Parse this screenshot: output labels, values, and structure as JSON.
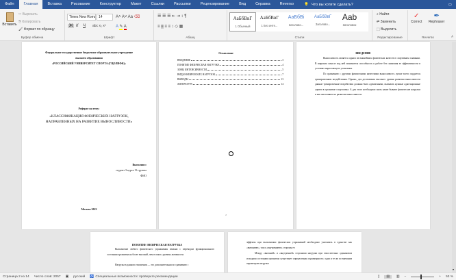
{
  "tabs": [
    "Файл",
    "Главная",
    "Вставка",
    "Рисование",
    "Конструктор",
    "Макет",
    "Ссылки",
    "Рассылки",
    "Рецензирование",
    "Вид",
    "Справка",
    "Reverso"
  ],
  "tell_me": "Что вы хотите сделать?",
  "clipboard": {
    "paste": "Вставить",
    "cut": "Вырезать",
    "copy": "Копировать",
    "format_painter": "Формат по образцу",
    "label": "Буфер обмена"
  },
  "font": {
    "name": "Times New Roman",
    "size": "14",
    "label": "Шрифт",
    "bold": "Ж",
    "italic": "К",
    "underline": "Ч"
  },
  "paragraph": {
    "label": "Абзац"
  },
  "styles": {
    "label": "Стили",
    "items": [
      {
        "preview": "АаБбВвГ",
        "name": "1 Обычный"
      },
      {
        "preview": "АаБбВвГ",
        "name": "1 Без инте..."
      },
      {
        "preview": "АаБбВі",
        "name": "Заголово..."
      },
      {
        "preview": "АаБбВвГ",
        "name": "Заголово..."
      },
      {
        "preview": "Aab",
        "name": "Заголовок"
      },
      {
        "preview": "АаБбВвГ",
        "name": "Подзагол..."
      }
    ]
  },
  "editing": {
    "label": "Редактирование",
    "find": "Найти",
    "replace": "Заменить",
    "select": "Выделить"
  },
  "reverso": {
    "label": "Reverso",
    "correct": "Correct",
    "rephraser": "Rephraser"
  },
  "page1": {
    "org1": "Федеральное государственное бюджетное образовательное учреждение",
    "org2": "высшего образования",
    "org3": "«РОССИЙСКИЙ УНИВЕРСИТЕТ СПОРТА (ГЦОЛИФК)»",
    "ref": "Реферат на тему:",
    "title1": "«КЛАССИФИКАЦИЯ ФИЗИЧЕСКИХ НАГРУЗОК,",
    "title2": "НАПРАВЛЕННЫХ НА РАЗВИТИЕ ВЫНОСЛИВОСТИ»",
    "done": "Выполнил:",
    "student": "студент 3 курса 13 группы",
    "fio": "ФИО",
    "city": "Москва 2022"
  },
  "page2": {
    "heading": "Оглавление",
    "toc": [
      {
        "t": "ВВЕДЕНИЕ",
        "p": "3"
      },
      {
        "t": "ПОНЯТИЕ ФИЗИЧЕСКАЯ НАГРУЗКА",
        "p": "4"
      },
      {
        "t": "ЗОНЫ ИНТЕНСИВНОСТИ",
        "p": "5"
      },
      {
        "t": "ВИДЫ ФИЗИЧЕСКИХ НАГРУЗОК",
        "p": "7"
      },
      {
        "t": "ВЫВОДЫ",
        "p": "13"
      },
      {
        "t": "ЛИТЕРАТУРА",
        "p": "14"
      }
    ],
    "num": "2"
  },
  "page3": {
    "heading": "ВВЕДЕНИЕ",
    "p1": "Выносливость является одним из важнейших физических качеств в спортивном плавании. В широком смысле под ней понимается способность к работе без снижения ее эффективности в условиях нарастающего утомления.",
    "p2": "По сравнению с другими физическими качествами выносливость лучше всего поддается тренировочным воздействиям. Однако, для достижения высокого уровня развития выносливости данные тренировочные воздействия должны быть адекватными, вызывать нужные адаптационные сдвиги в организме спортсмена. А для этого необходимо знать какие бывают физические нагрузки и как они влияют на развитие выносливости."
  },
  "page4": {
    "heading": "ПОНЯТИЕ ФИЗИЧЕСКАЯ НАГРУЗКА",
    "p1": "Выполнение любого физического упражнения связано с переводом функционального состояния организма на более высокий, чем в покое, уровень активности.",
    "p2": "Нагрузка в данном отношении — это дополнительная по сравнению с"
  },
  "page5": {
    "p1": "эффекты при выполнении физических упражнений необходимо учитывать в единстве как «внешнюю», так и «внутреннюю» стороны ее.",
    "p2": "Между «внешней» и «внутренней» сторонами нагрузки при относительно одинаковом исходном состоянии организма существует определенная соразмерность: одни и те же по внешним параметрам нагрузки"
  },
  "status": {
    "page": "Страница 2 из 14",
    "words": "Число слов: 2057",
    "lang": "русский",
    "access": "Специальные возможности: проверьте рекомендации",
    "zoom": "53 %",
    "zoom_value": 53
  }
}
